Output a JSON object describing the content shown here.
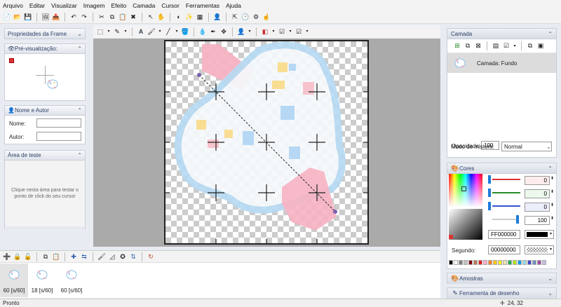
{
  "menu": [
    "Arquivo",
    "Editar",
    "Visualizar",
    "Imagem",
    "Efeito",
    "Camada",
    "Cursor",
    "Ferramentas",
    "Ajuda"
  ],
  "left": {
    "frame_props": "Propriedades da Frame",
    "preview": "Pré-visualização:",
    "name_author": "Nome e Autor",
    "name_label": "Nome:",
    "author_label": "Autor:",
    "test_area": "Área de teste",
    "test_hint": "Clique nesta área para testar o ponto de click do seu cursor"
  },
  "right": {
    "layer_title": "Camada",
    "layer_name": "Camada: Fundo",
    "opacity_label": "Opacidade:",
    "opacity_value": "100",
    "blend_label": "Modo de mistura:",
    "blend_value": "Normal",
    "colors_title": "Cores",
    "r": "0",
    "g": "0",
    "b": "0",
    "a": "100",
    "hex": "FF000000",
    "secondary_label": "Segundo:",
    "secondary_hex": "00000000",
    "samples_title": "Amostras",
    "drawtool_title": "Ferramenta de desenho"
  },
  "frames": [
    {
      "label": "60 [s/60]"
    },
    {
      "label": "18 [s/60]"
    },
    {
      "label": "60 [s/60]"
    }
  ],
  "palette": [
    "#000000",
    "#ffffff",
    "#7f7f7f",
    "#c3c3c3",
    "#880015",
    "#b97a57",
    "#ed1c24",
    "#ffaec9",
    "#ff7f27",
    "#ffc90e",
    "#fff200",
    "#efe4b0",
    "#22b14c",
    "#b5e61d",
    "#00a2e8",
    "#99d9ea",
    "#3f48cc",
    "#7092be",
    "#a349a4",
    "#c8bfe7"
  ],
  "status": {
    "left": "Pronto",
    "coords": "24, 32"
  }
}
